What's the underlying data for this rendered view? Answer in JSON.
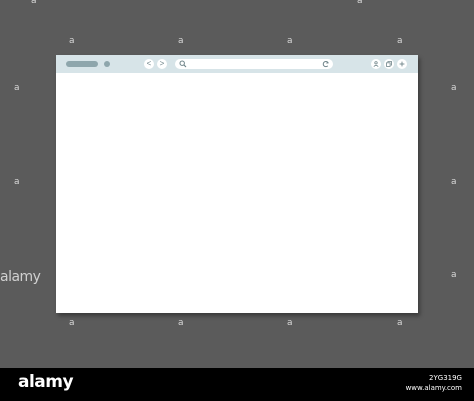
{
  "watermark": {
    "glyph": "a",
    "side_text": "alamy"
  },
  "browser": {
    "toolbar": {
      "back_glyph": "<",
      "forward_glyph": ">"
    },
    "address_bar": {
      "value": "",
      "left_icon": "search-icon",
      "right_icon": "reload-icon"
    },
    "window_buttons": [
      "user-icon",
      "copy-icon",
      "plus-icon"
    ],
    "colors": {
      "toolbar": "#d7e4e8",
      "controls": "#8ea6ac",
      "page": "#ffffff",
      "backdrop": "#5b5b5b"
    }
  },
  "footer": {
    "logo": "alamy",
    "image_id": "2YG319G",
    "site": "www.alamy.com"
  }
}
